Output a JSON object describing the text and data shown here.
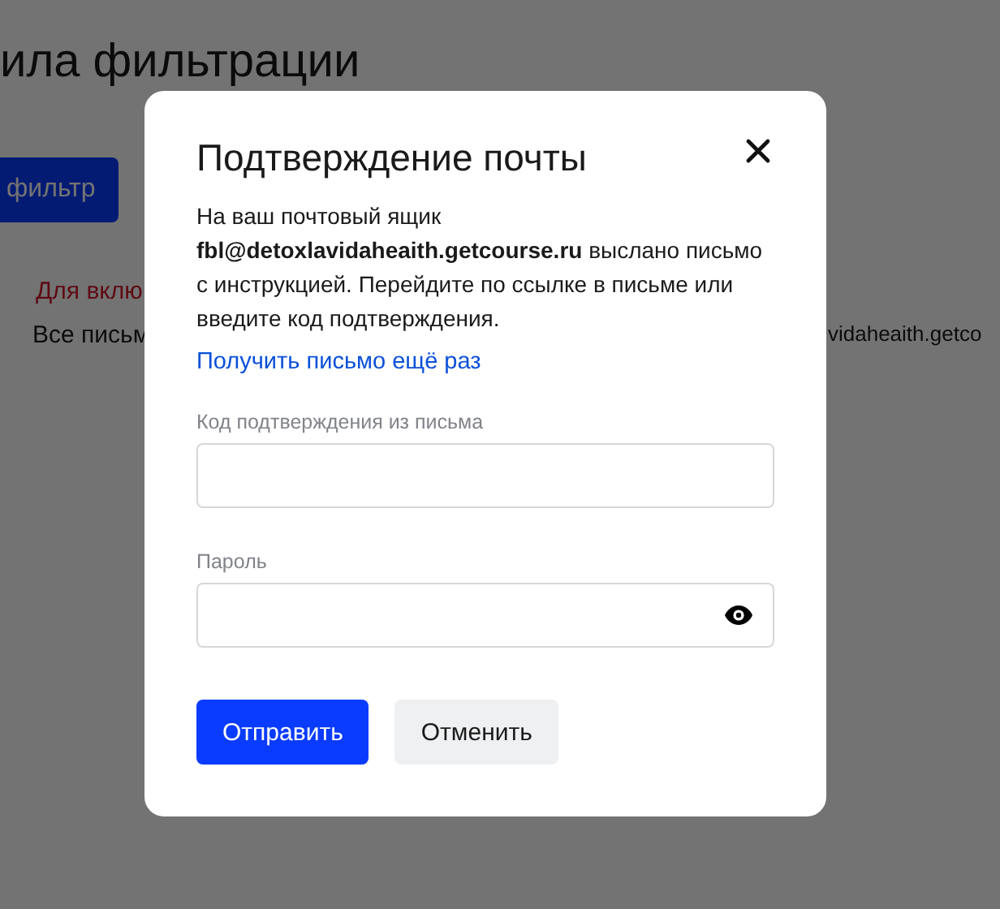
{
  "page": {
    "title": "ила фильтрации",
    "add_button": "фильтр",
    "notice": "Для вклю",
    "line_start": "Все письм",
    "line_end": "vidaheaith.getco"
  },
  "dialog": {
    "title": "Подтверждение почты",
    "message": "На ваш почтовый ящик **fbl@detoxlavidaheaith.getcourse.ru** выслано письмо с инструкцией. Перейдите по ссылке в письме или введите код подтверждения.",
    "resend_link": "Получить письмо ещё раз",
    "fields": [
      {
        "label": "Код подтверждения из письма",
        "kind": "text"
      },
      {
        "label": "Пароль",
        "kind": "password"
      }
    ],
    "buttons": [
      {
        "label": "Отправить",
        "kind": "primary"
      },
      {
        "label": "Отменить",
        "kind": "secondary"
      }
    ]
  }
}
